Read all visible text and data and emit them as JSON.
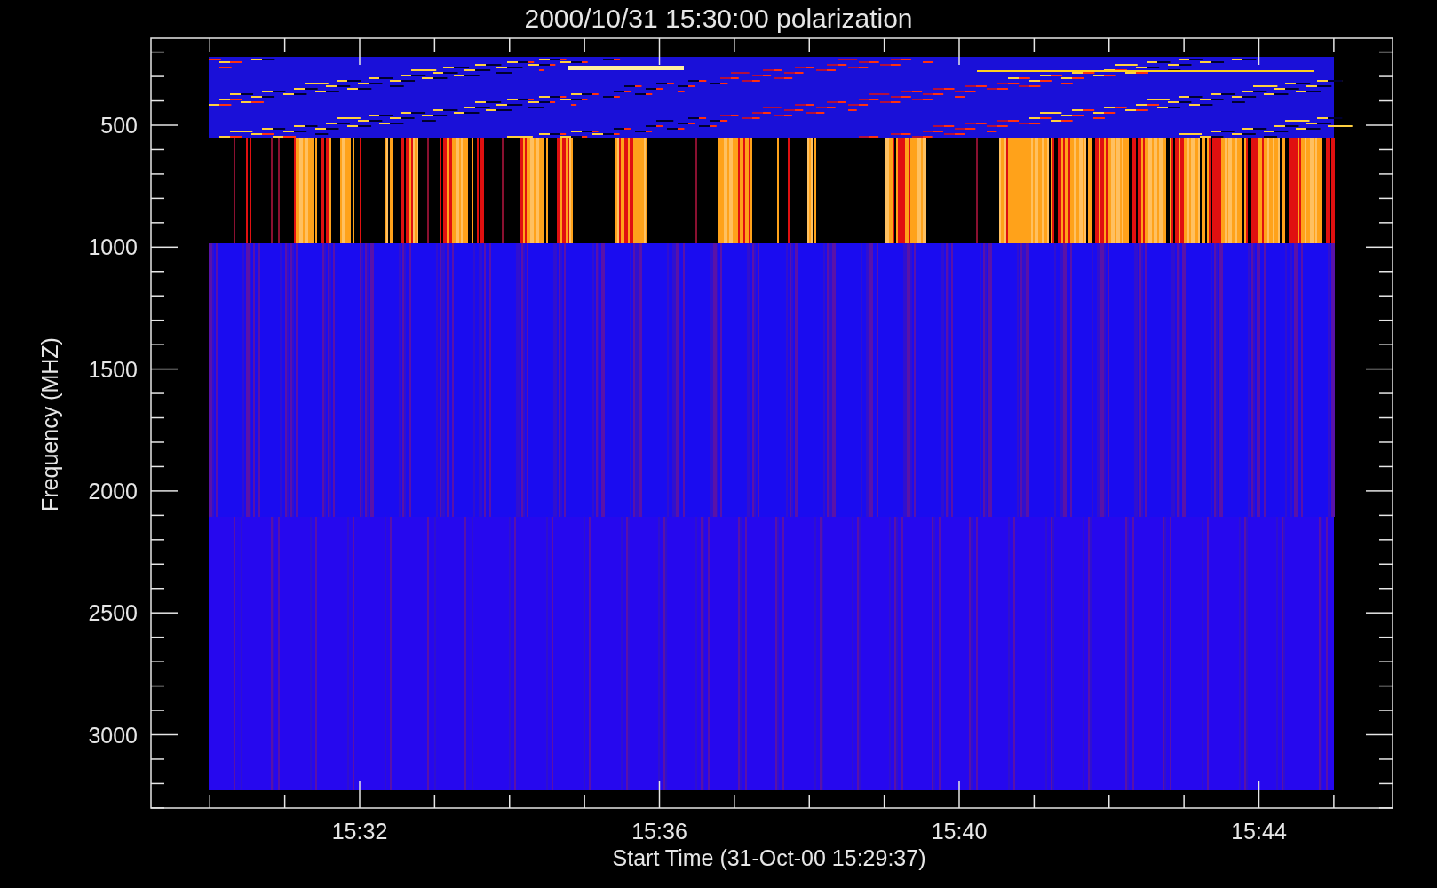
{
  "plot": {
    "title": "2000/10/31 15:30:00 polarization",
    "ylabel": "Frequency (MHZ)",
    "xlabel": "Start Time (31-Oct-00 15:29:37)",
    "yticks": [
      "500",
      "1000",
      "1500",
      "2000",
      "2500",
      "3000"
    ],
    "xticks": [
      "15:32",
      "15:36",
      "15:40",
      "15:44"
    ]
  }
}
